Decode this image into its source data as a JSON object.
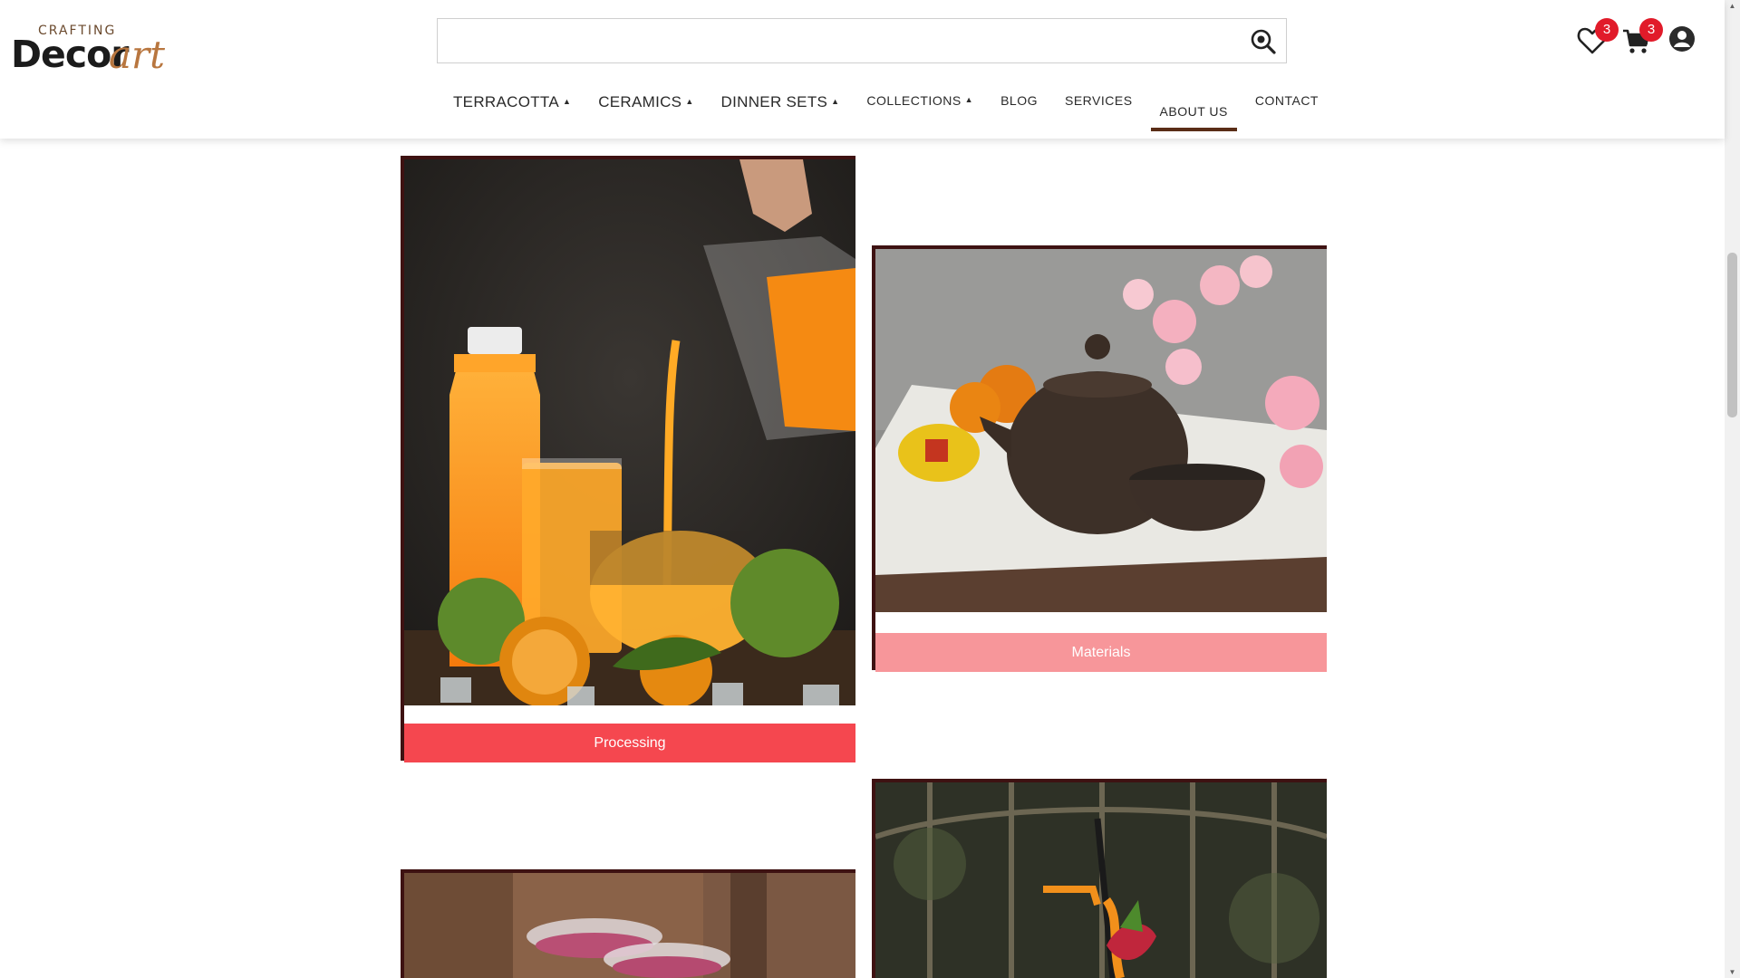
{
  "brand": {
    "small": "CRAFTING",
    "name": "Decor",
    "script": "art"
  },
  "search": {
    "value": "",
    "placeholder": ""
  },
  "wishlist": {
    "count": "3"
  },
  "cart": {
    "count": "3"
  },
  "nav": [
    {
      "label": "TERRACOTTA",
      "caret": "▲"
    },
    {
      "label": "CERAMICS",
      "caret": "▲"
    },
    {
      "label": "DINNER SETS",
      "caret": "▲"
    },
    {
      "label": "COLLECTIONS",
      "caret": "▲"
    },
    {
      "label": "BLOG"
    },
    {
      "label": "SERVICES"
    },
    {
      "label": "ABOUT US",
      "active": true
    },
    {
      "label": "CONTACT"
    }
  ],
  "cards": [
    {
      "label": "Processing",
      "color": "#f5474f"
    },
    {
      "label": "Materials",
      "color": "#f7969a"
    }
  ],
  "colors": {
    "accent": "#5a2d17",
    "badge": "#e11b2a",
    "card_border": "#3e1212"
  }
}
